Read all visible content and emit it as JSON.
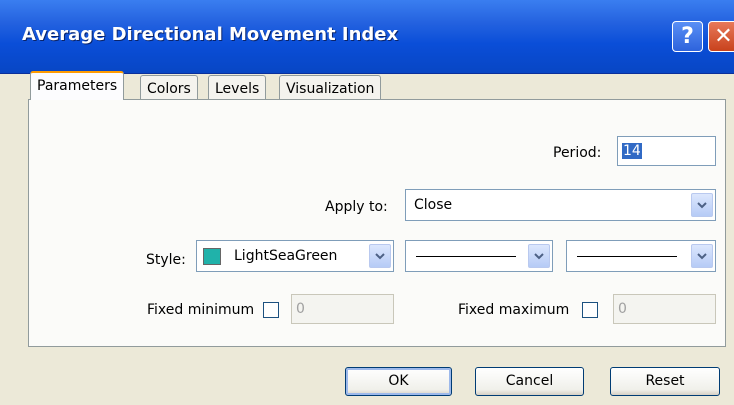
{
  "window": {
    "title": "Average Directional Movement Index",
    "help_label": "?",
    "close_label": "✕"
  },
  "tabs": [
    {
      "label": "Parameters",
      "active": true
    },
    {
      "label": "Colors",
      "active": false
    },
    {
      "label": "Levels",
      "active": false
    },
    {
      "label": "Visualization",
      "active": false
    }
  ],
  "params": {
    "period_label": "Period:",
    "period_value": "14",
    "apply_label": "Apply to:",
    "apply_value": "Close",
    "style_label": "Style:",
    "style_color_name": "LightSeaGreen",
    "style_color_hex": "#20b2aa",
    "fixed_min_label": "Fixed minimum",
    "fixed_min_value": "0",
    "fixed_max_label": "Fixed maximum",
    "fixed_max_value": "0"
  },
  "buttons": {
    "ok": "OK",
    "cancel": "Cancel",
    "reset": "Reset"
  }
}
